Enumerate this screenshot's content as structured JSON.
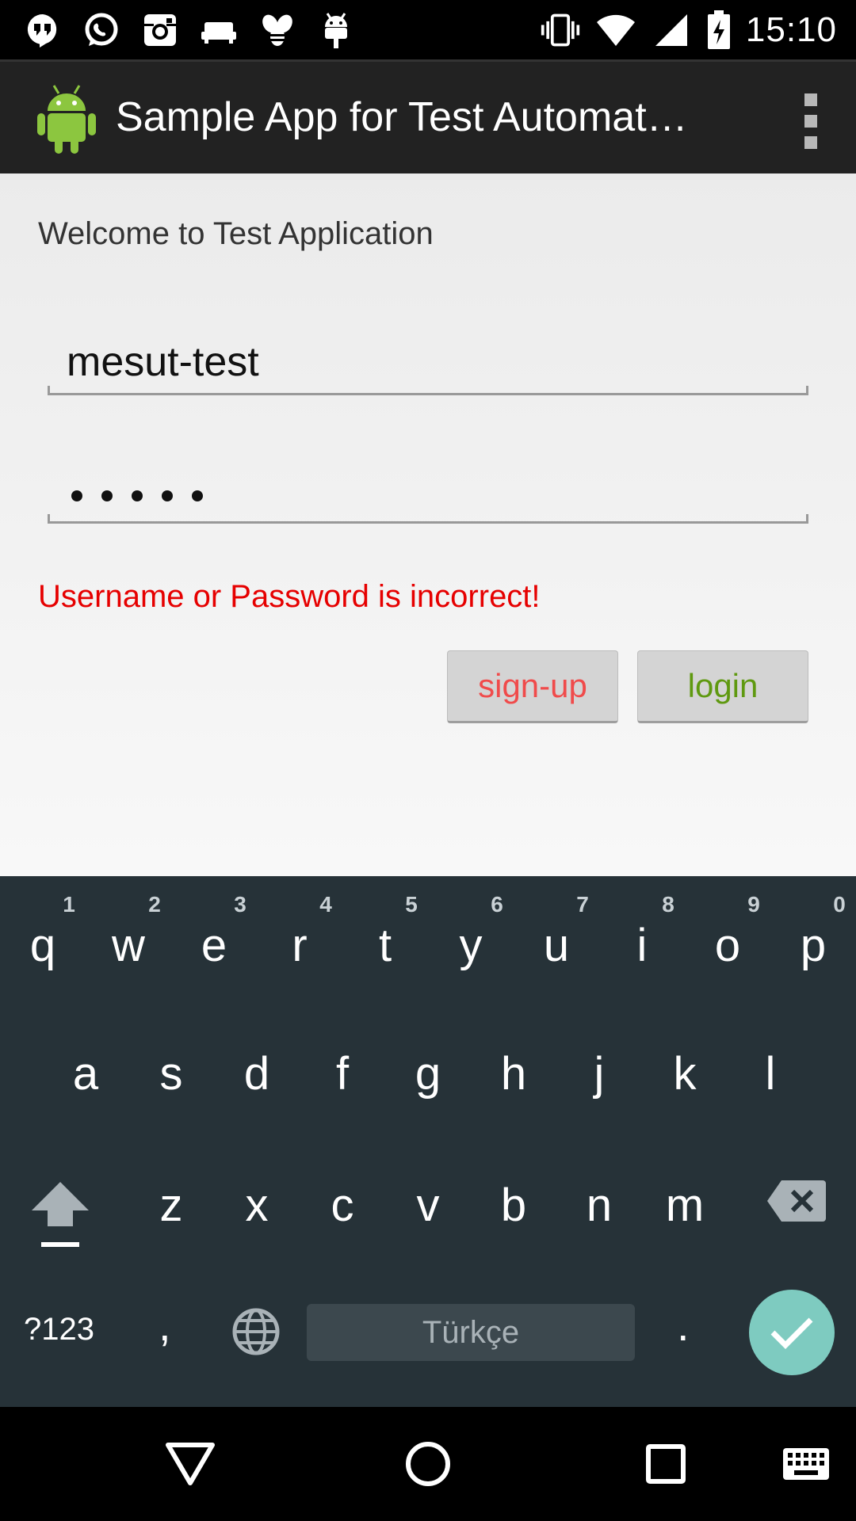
{
  "status_bar": {
    "time": "15:10",
    "left_icons": [
      "hangouts-icon",
      "whatsapp-icon",
      "instagram-icon",
      "sofa-icon",
      "bee-icon",
      "android-debug-icon"
    ],
    "right_icons": [
      "vibrate-icon",
      "wifi-icon",
      "cell-signal-icon",
      "battery-charging-icon"
    ]
  },
  "action_bar": {
    "title": "Sample App for Test Automat…",
    "app_icon": "android-robot-icon",
    "menu_icon": "overflow-menu-icon"
  },
  "form": {
    "welcome": "Welcome to Test Application",
    "username_value": "mesut-test",
    "password_mask": "•••••",
    "password_length": 5,
    "error_message": "Username or Password is incorrect!",
    "signup_label": "sign-up",
    "login_label": "login"
  },
  "keyboard": {
    "row1": [
      {
        "k": "q",
        "h": "1"
      },
      {
        "k": "w",
        "h": "2"
      },
      {
        "k": "e",
        "h": "3"
      },
      {
        "k": "r",
        "h": "4"
      },
      {
        "k": "t",
        "h": "5"
      },
      {
        "k": "y",
        "h": "6"
      },
      {
        "k": "u",
        "h": "7"
      },
      {
        "k": "i",
        "h": "8"
      },
      {
        "k": "o",
        "h": "9"
      },
      {
        "k": "p",
        "h": "0"
      }
    ],
    "row2": [
      "a",
      "s",
      "d",
      "f",
      "g",
      "h",
      "j",
      "k",
      "l"
    ],
    "row3": [
      "z",
      "x",
      "c",
      "v",
      "b",
      "n",
      "m"
    ],
    "symbols_label": "?123",
    "comma_label": ",",
    "period_label": ".",
    "space_label": "Türkçe",
    "accent_color": "#7ecbc0"
  },
  "nav_bar": {
    "buttons": [
      "back-icon",
      "home-icon",
      "recents-icon",
      "keyboard-switch-icon"
    ]
  }
}
